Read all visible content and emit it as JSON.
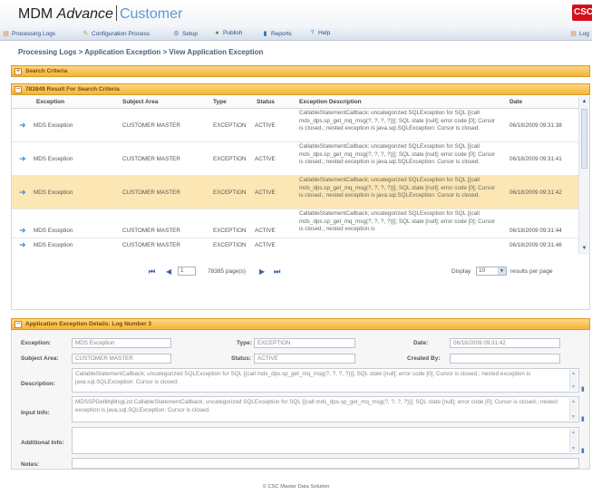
{
  "app": {
    "brand": "MDM",
    "brand_italic": "Advance",
    "module": "Customer",
    "corner_logo": "CSC"
  },
  "nav": [
    {
      "label": "Processing Logs",
      "icon": "processing-logs-icon"
    },
    {
      "label": "Configuration Process",
      "icon": "configuration-icon"
    },
    {
      "label": "Setup",
      "icon": "gear-icon"
    },
    {
      "label": "Publish",
      "icon": "publish-icon"
    },
    {
      "label": "Reports",
      "icon": "reports-icon"
    },
    {
      "label": "Help",
      "icon": "help-icon"
    },
    {
      "label": "Log",
      "icon": "log-icon"
    }
  ],
  "breadcrumb": "Processing Logs > Application Exception > View Application Exception",
  "search_panel": {
    "title": "Search Criteria",
    "toggle": "+"
  },
  "results_panel": {
    "title": "783849 Result For Search Criteria",
    "toggle": "−"
  },
  "columns": [
    "Exception",
    "Subject Area",
    "Type",
    "Status",
    "Exception Description",
    "Date"
  ],
  "rows": [
    {
      "exception": "MDS Exception",
      "subject": "CUSTOMER MASTER",
      "type": "EXCEPTION",
      "status": "ACTIVE",
      "desc": "CallableStatementCallback; uncategorized SQLException for SQL [{call mds_dps.sp_get_mq_msg(?, ?, ?, ?)}]; SQL state [null]; error code [0]; Cursor is closed.; nested exception is java.sql.SQLException: Cursor is closed.",
      "date": "06/18/2009 09:31:38"
    },
    {
      "exception": "MDS Exception",
      "subject": "CUSTOMER MASTER",
      "type": "EXCEPTION",
      "status": "ACTIVE",
      "desc": "CallableStatementCallback; uncategorized SQLException for SQL [{call mds_dps.sp_get_mq_msg(?, ?, ?, ?)}]; SQL state [null]; error code [0]; Cursor is closed.; nested exception is java.sql.SQLException: Cursor is closed.",
      "date": "06/18/2009 09:31:41"
    },
    {
      "exception": "MDS Exception",
      "subject": "CUSTOMER MASTER",
      "type": "EXCEPTION",
      "status": "ACTIVE",
      "desc": "CallableStatementCallback; uncategorized SQLException for SQL [{call mds_dps.sp_get_mq_msg(?, ?, ?, ?)}]; SQL state [null]; error code [0]; Cursor is closed.; nested exception is java.sql.SQLException: Cursor is closed.",
      "date": "06/18/2009 09:31:42"
    },
    {
      "exception": "MDS Exception",
      "subject": "CUSTOMER MASTER",
      "type": "EXCEPTION",
      "status": "ACTIVE",
      "desc": "CallableStatementCallback; uncategorized SQLException for SQL [{call mds_dps.sp_get_mq_msg(?, ?, ?, ?)}]; SQL state [null]; error code [0]; Cursor is closed.; nested exception is",
      "date": "06/18/2009 09:31:44"
    },
    {
      "exception": "MDS Exception",
      "subject": "CUSTOMER MASTER",
      "type": "EXCEPTION",
      "status": "ACTIVE",
      "desc": "",
      "date": "06/18/2009 09:31:46"
    }
  ],
  "pager": {
    "first": "⏮",
    "prev": "◀",
    "page": "1",
    "pages_text": "78385 page(s)",
    "next": "▶",
    "last": "⏭",
    "display_label": "Display",
    "page_size": "10",
    "per_page_label": "results per page"
  },
  "details_panel": {
    "title": "Application Exception Details: Log Number 3",
    "toggle": "−"
  },
  "details": {
    "exception_label": "Exception:",
    "exception": "MDS Exception",
    "type_label": "Type:",
    "type": "EXCEPTION",
    "date_label": "Date:",
    "date": "06/18/2009 09:31:42",
    "subject_label": "Subject Area:",
    "subject": "CUSTOMER MASTER",
    "status_label": "Status:",
    "status": "ACTIVE",
    "created_label": "Created By:",
    "created": "",
    "description_label": "Description:",
    "description": "CallableStatementCallback; uncategorized SQLException for SQL [{call mds_dps.sp_get_mq_msg(?, ?, ?, ?)}]; SQL state [null]; error code [0]; Cursor is closed.; nested exception is java.sql.SQLException: Cursor is closed.",
    "input_label": "Input Info:",
    "input": "MDSSPGetMqMsgList:CallableStatementCallback; uncategorized SQLException for SQL [{call mds_dps.sp_get_mq_msg(?, ?, ?, ?)}]; SQL state [null]; error code [0]; Cursor is closed.; nested exception is java.sql.SQLException: Cursor is closed.",
    "additional_label": "Additional Info:",
    "additional": "",
    "notes_label": "Notes:",
    "notes": ""
  },
  "footer": "© CSC Master Data Solution"
}
